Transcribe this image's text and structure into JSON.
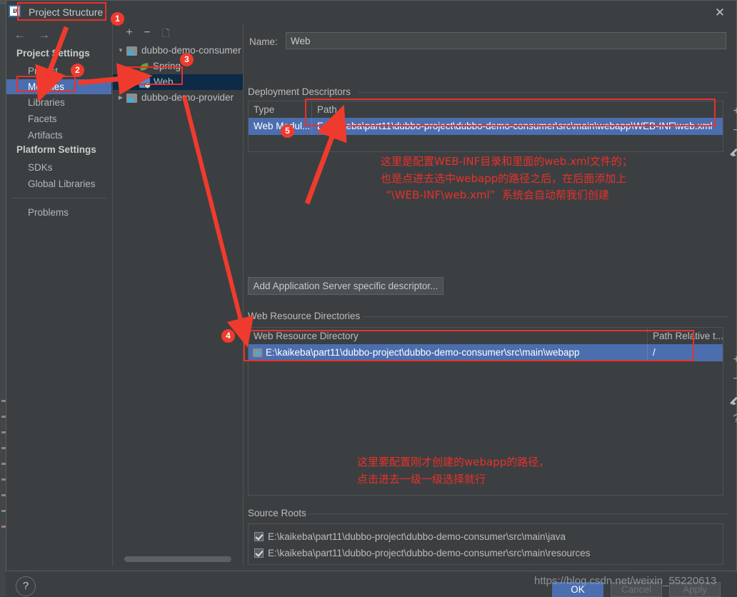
{
  "window": {
    "title": "Project Structure",
    "close_icon": "close-icon",
    "logo": "intellij-idea-logo"
  },
  "sidebar": {
    "back_icon": "arrow-left-icon",
    "forward_icon": "arrow-right-icon",
    "sections": [
      {
        "title": "Project Settings",
        "items": [
          {
            "label": "Project",
            "selected": false
          },
          {
            "label": "Modules",
            "selected": true
          },
          {
            "label": "Libraries",
            "selected": false
          },
          {
            "label": "Facets",
            "selected": false
          },
          {
            "label": "Artifacts",
            "selected": false
          }
        ]
      },
      {
        "title": "Platform Settings",
        "items": [
          {
            "label": "SDKs",
            "selected": false
          },
          {
            "label": "Global Libraries",
            "selected": false
          }
        ]
      }
    ],
    "footer_items": [
      {
        "label": "Problems",
        "selected": false
      }
    ]
  },
  "tree": {
    "toolbar": {
      "add_icon": "plus-icon",
      "remove_icon": "minus-icon",
      "copy_icon": "copy-icon"
    },
    "nodes": [
      {
        "label": "dubbo-demo-consumer",
        "icon": "folder-module-icon",
        "depth": 0,
        "expanded": true,
        "selected": false
      },
      {
        "label": "Spring",
        "icon": "spring-leaf-icon",
        "depth": 1,
        "expanded": null,
        "selected": false
      },
      {
        "label": "Web",
        "icon": "web-facet-icon",
        "depth": 1,
        "expanded": null,
        "selected": true
      },
      {
        "label": "dubbo-demo-provider",
        "icon": "folder-module-icon",
        "depth": 0,
        "expanded": false,
        "selected": false
      }
    ]
  },
  "main": {
    "name_label": "Name:",
    "name_value": "Web",
    "deployment": {
      "group_title": "Deployment Descriptors",
      "columns": [
        "Type",
        "Path"
      ],
      "rows": [
        {
          "type": "Web Modul...",
          "path": "E:\\kaikeba\\part11\\dubbo-project\\dubbo-demo-consumer\\src\\main\\webapp\\WEB-INF\\web.xml",
          "selected": true
        }
      ],
      "icons": [
        "plus-icon",
        "minus-icon",
        "pencil-icon"
      ],
      "add_button": "Add Application Server specific descriptor..."
    },
    "web_resources": {
      "group_title": "Web Resource Directories",
      "columns": [
        "Web Resource Directory",
        "Path Relative t..."
      ],
      "rows": [
        {
          "directory": "E:\\kaikeba\\part11\\dubbo-project\\dubbo-demo-consumer\\src\\main\\webapp",
          "relative": "/",
          "icon": "folder-icon",
          "selected": true
        }
      ],
      "icons": [
        "plus-icon",
        "minus-icon",
        "pencil-icon",
        "help-icon"
      ]
    },
    "source_roots": {
      "group_title": "Source Roots",
      "items": [
        {
          "label": "E:\\kaikeba\\part11\\dubbo-project\\dubbo-demo-consumer\\src\\main\\java",
          "checked": true
        },
        {
          "label": "E:\\kaikeba\\part11\\dubbo-project\\dubbo-demo-consumer\\src\\main\\resources",
          "checked": true
        }
      ]
    }
  },
  "footer": {
    "help_icon": "question-mark-icon",
    "ok_label": "OK",
    "cancel_label": "Cancel",
    "apply_label": "Apply",
    "watermark": "https://blog.csdn.net/weixin_55220613"
  },
  "annotations": {
    "badges": [
      "1",
      "2",
      "3",
      "4",
      "5"
    ],
    "note_descriptor_line1": "这里是配置WEB-INF目录和里面的web.xml文件的；",
    "note_descriptor_line2": "也是点进去选中webapp的路径之后，在后面添加上",
    "note_descriptor_line3": "“\\WEB-INF\\web.xml”  系统会自动帮我们创建",
    "note_webres_line1": "这里要配置刚才创建的webapp的路径，",
    "note_webres_line2": "点击进去一级一级选择就行",
    "accent_color": "#e8312a",
    "selection_color": "#4b6eaf"
  }
}
